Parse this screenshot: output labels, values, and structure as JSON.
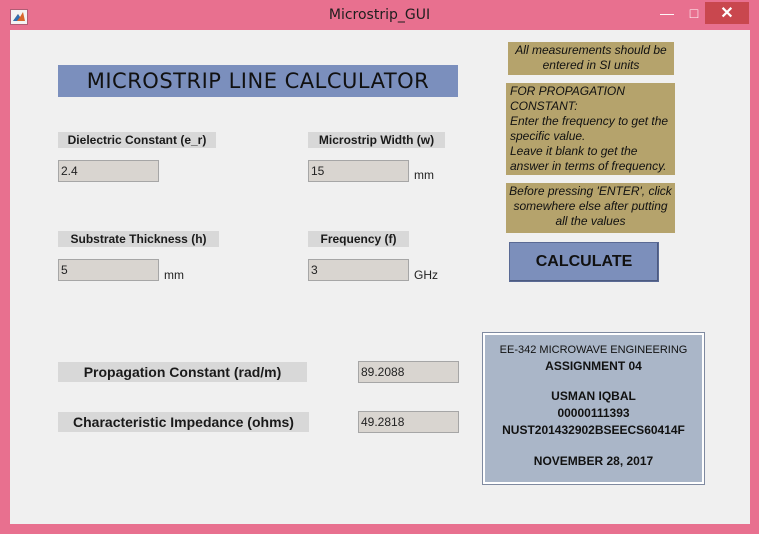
{
  "window": {
    "title": "Microstrip_GUI",
    "minimize_glyph": "—",
    "maximize_glyph": "□",
    "close_glyph": "✕",
    "app_icon": "matlab-icon"
  },
  "main": {
    "title": "MICROSTRIP LINE CALCULATOR",
    "dielectric": {
      "label": "Dielectric Constant (e_r)",
      "value": "2.4"
    },
    "width": {
      "label": "Microstrip Width (w)",
      "value": "15",
      "unit": "mm"
    },
    "thickness": {
      "label": "Substrate Thickness (h)",
      "value": "5",
      "unit": "mm"
    },
    "frequency": {
      "label": "Frequency (f)",
      "value": "3",
      "unit": "GHz"
    },
    "propagation": {
      "label": "Propagation Constant (rad/m)",
      "value": "89.2088"
    },
    "impedance": {
      "label": "Characteristic Impedance (ohms)",
      "value": "49.2818"
    },
    "calculate_label": "CALCULATE"
  },
  "notes": {
    "si_units": [
      "All measurements should be",
      "entered in SI units"
    ],
    "propagation": [
      "FOR PROPAGATION",
      "CONSTANT:",
      "Enter the frequency to get the",
      "specific value.",
      "Leave it blank to get the",
      "answer in terms of frequency."
    ],
    "enter": [
      "Before pressing 'ENTER', click",
      "somewhere else after putting",
      "all the values"
    ]
  },
  "info": {
    "course": "EE-342 MICROWAVE ENGINEERING",
    "assignment": "ASSIGNMENT 04",
    "name": "USMAN IQBAL",
    "id": "00000111393",
    "reg": "NUST201432902BSEECS60414F",
    "date": "NOVEMBER 28, 2017"
  },
  "colors": {
    "window_frame": "#e8708f",
    "title_banner": "#7b8fbd",
    "note_bg": "#b5a36c",
    "info_bg": "#aab6c8",
    "close_button": "#c9474e"
  }
}
